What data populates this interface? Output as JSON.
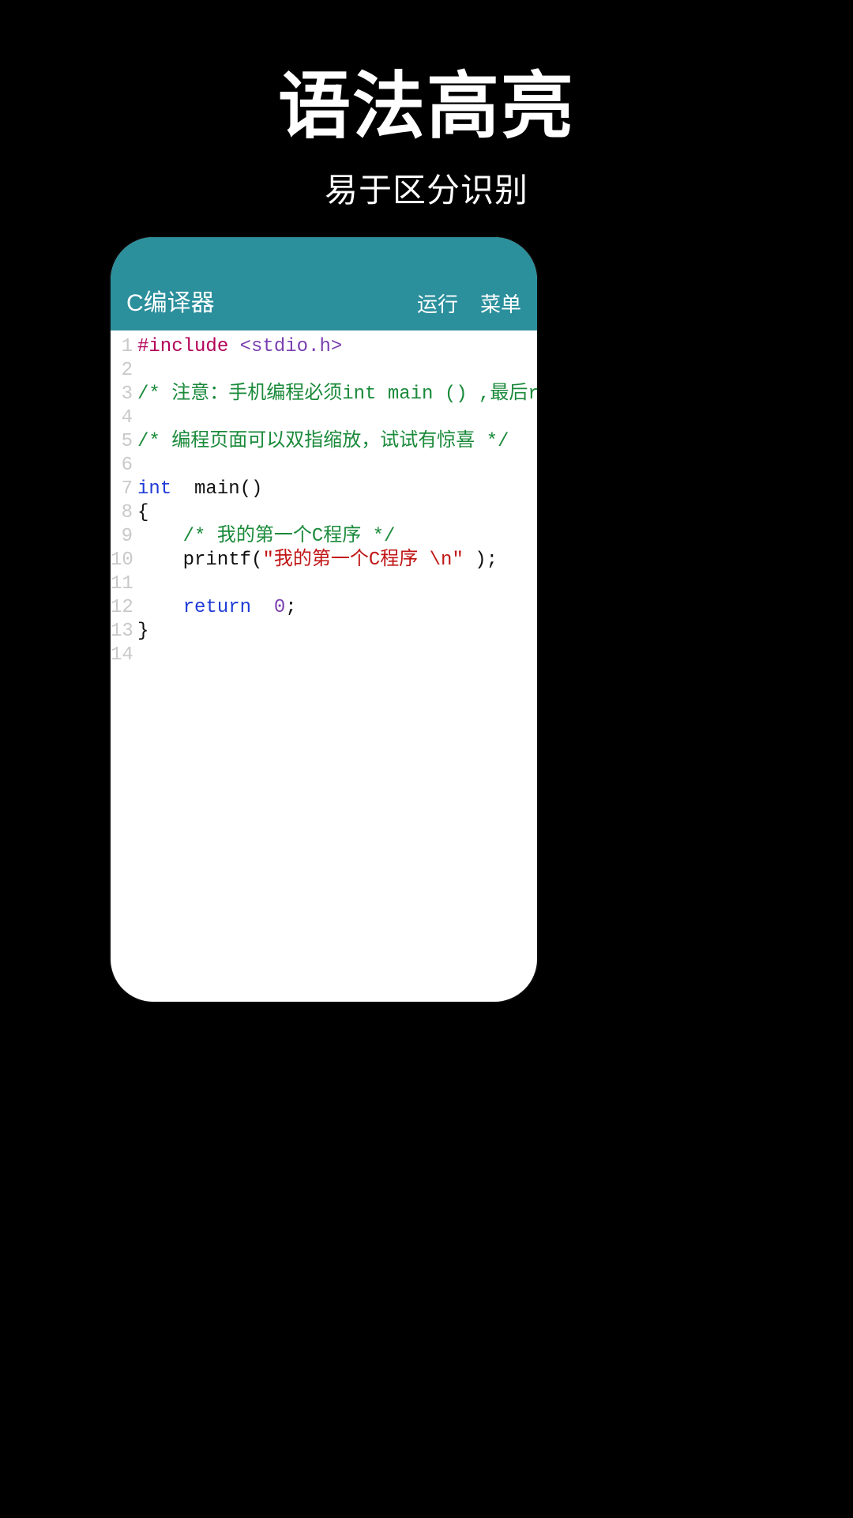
{
  "heading": {
    "title": "语法高亮",
    "subtitle": "易于区分识别"
  },
  "appbar": {
    "title": "C编译器",
    "run_label": "运行",
    "menu_label": "菜单"
  },
  "code": {
    "lines": [
      [
        {
          "t": "#include ",
          "c": "include"
        },
        {
          "t": "<stdio.h>",
          "c": "anglestr"
        }
      ],
      [],
      [
        {
          "t": "/* 注意：手机编程必须int main () ,最后re",
          "c": "comment"
        }
      ],
      [],
      [
        {
          "t": "/* 编程页面可以双指缩放，试试有惊喜 */",
          "c": "comment"
        }
      ],
      [],
      [
        {
          "t": "int",
          "c": "keyword"
        },
        {
          "t": "  ",
          "c": "punct"
        },
        {
          "t": "main",
          "c": "ident"
        },
        {
          "t": "()",
          "c": "punct"
        }
      ],
      [
        {
          "t": "{",
          "c": "punct"
        }
      ],
      [
        {
          "t": "    ",
          "c": "punct"
        },
        {
          "t": "/* 我的第一个C程序 */",
          "c": "comment"
        }
      ],
      [
        {
          "t": "    ",
          "c": "punct"
        },
        {
          "t": "printf(",
          "c": "ident"
        },
        {
          "t": "\"我的第一个C程序 \\n\"",
          "c": "string"
        },
        {
          "t": " );",
          "c": "punct"
        }
      ],
      [],
      [
        {
          "t": "    ",
          "c": "punct"
        },
        {
          "t": "return",
          "c": "keyword"
        },
        {
          "t": "  ",
          "c": "punct"
        },
        {
          "t": "0",
          "c": "number"
        },
        {
          "t": ";",
          "c": "punct"
        }
      ],
      [
        {
          "t": "}",
          "c": "punct"
        }
      ],
      []
    ]
  }
}
